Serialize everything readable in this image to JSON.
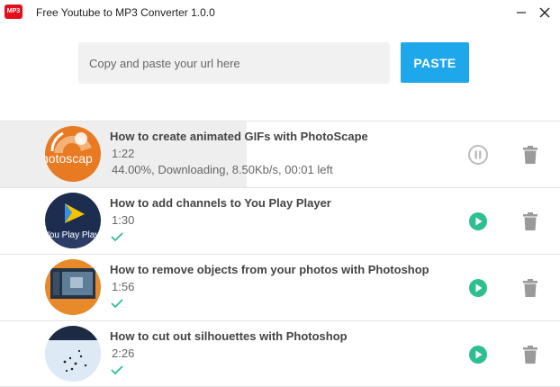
{
  "window": {
    "icon_text": "MP3",
    "title": "Free Youtube to MP3 Converter 1.0.0",
    "minimize_icon": "minimize-icon",
    "close_icon": "close-icon"
  },
  "url_bar": {
    "placeholder": "Copy and paste your url here",
    "value": "",
    "paste_label": "PASTE"
  },
  "colors": {
    "accent": "#1ea7ea",
    "success": "#2ebf91",
    "disabled": "#bbbbbb",
    "title_text": "#444444",
    "app_icon": "#e3101b"
  },
  "items": [
    {
      "title": "How to create animated GIFs with PhotoScape",
      "duration": "1:22",
      "status": "44.00%, Downloading, 8.50Kb/s, 00:01 left",
      "progress": 0.44,
      "thumb_text": "hotoscap",
      "state": "downloading",
      "action_icon": "pause-icon"
    },
    {
      "title": "How to add channels to You Play Player",
      "duration": "1:30",
      "thumb_text": "You Play Playe",
      "state": "done",
      "action_icon": "play-icon"
    },
    {
      "title": "How to remove objects from your photos with Photoshop",
      "duration": "1:56",
      "state": "done",
      "action_icon": "play-icon"
    },
    {
      "title": "How to cut out silhouettes with Photoshop",
      "duration": "2:26",
      "state": "done",
      "action_icon": "play-icon"
    }
  ]
}
